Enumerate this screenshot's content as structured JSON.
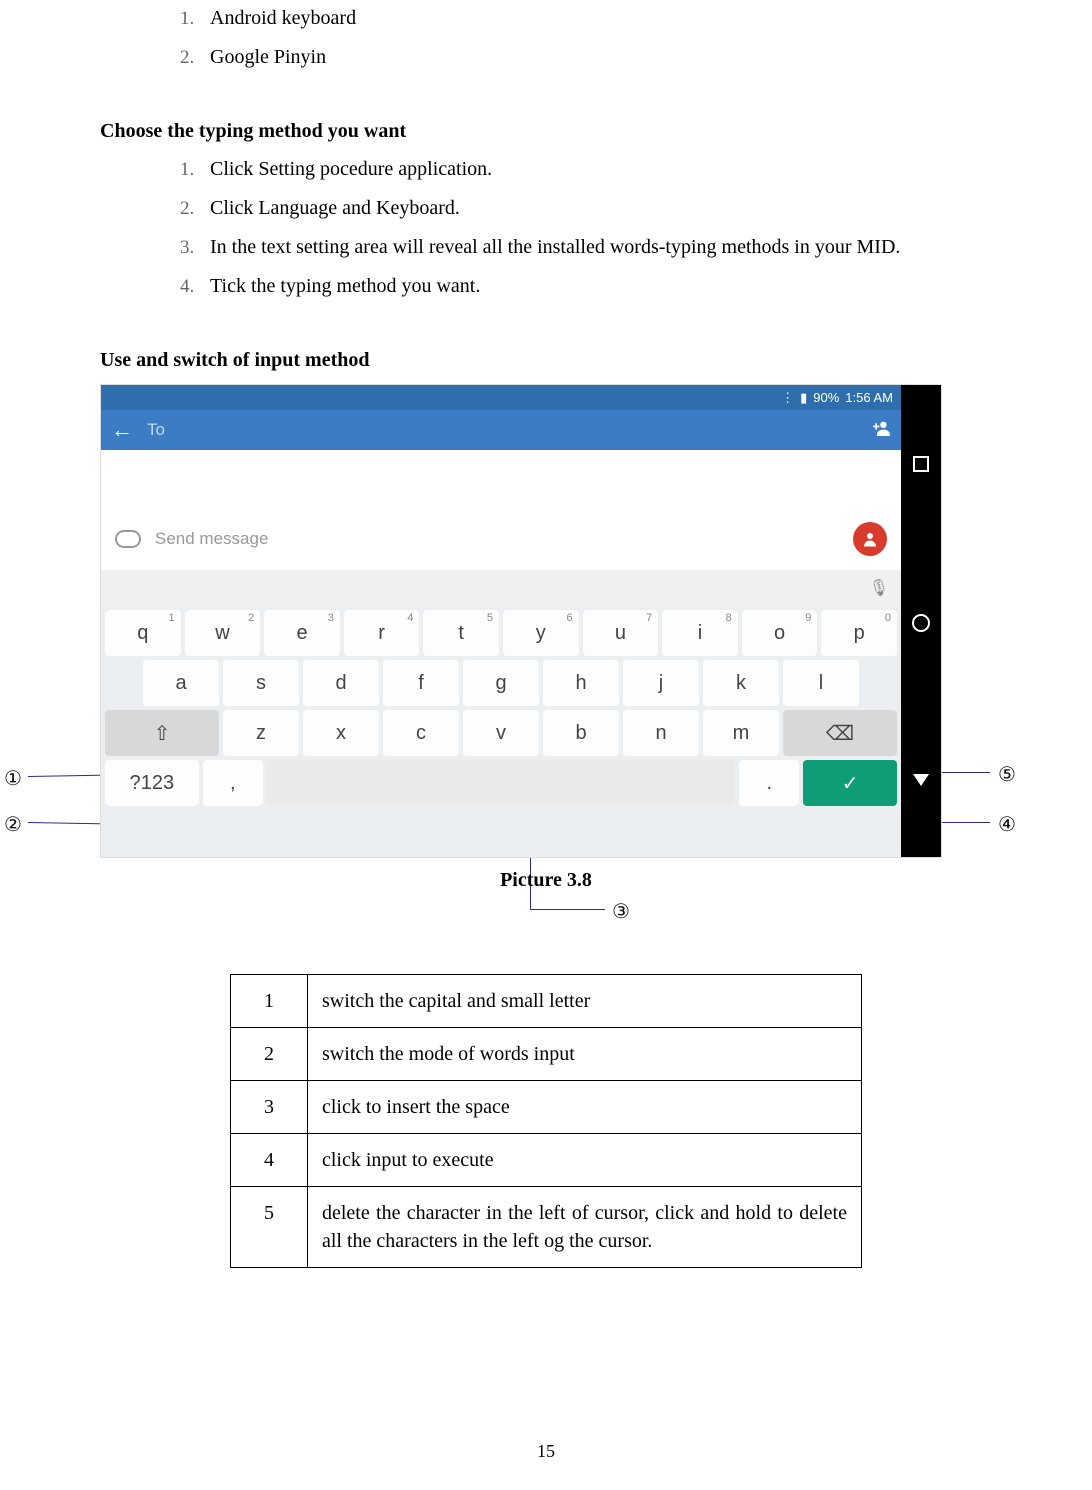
{
  "list_a": {
    "items": [
      {
        "n": "1.",
        "t": "Android keyboard"
      },
      {
        "n": "2.",
        "t": "Google Pinyin"
      }
    ]
  },
  "sect_choose": "Choose the typing method you want",
  "list_b": {
    "items": [
      {
        "n": "1.",
        "t": "Click Setting pocedure application."
      },
      {
        "n": "2.",
        "t": "Click Language and Keyboard."
      },
      {
        "n": "3.",
        "t": "In the text setting area will reveal all the installed words-typing methods in your MID."
      },
      {
        "n": "4.",
        "t": "Tick the typing method you want."
      }
    ]
  },
  "sect_use": "Use and switch of input method",
  "caption": "Picture 3.8",
  "callouts": {
    "c1": "①",
    "c2": "②",
    "c3": "③",
    "c4": "④",
    "c5": "⑤"
  },
  "shot": {
    "status": {
      "battery": "90%",
      "time": "1:56 AM",
      "bt": "▮"
    },
    "topbar": {
      "back": "←",
      "to": "To",
      "add": "+👤"
    },
    "msg": {
      "placeholder": "Send message"
    },
    "mic": "🎙",
    "kbd": {
      "row1": [
        [
          "q",
          "1"
        ],
        [
          "w",
          "2"
        ],
        [
          "e",
          "3"
        ],
        [
          "r",
          "4"
        ],
        [
          "t",
          "5"
        ],
        [
          "y",
          "6"
        ],
        [
          "u",
          "7"
        ],
        [
          "i",
          "8"
        ],
        [
          "o",
          "9"
        ],
        [
          "p",
          "0"
        ]
      ],
      "row2": [
        "a",
        "s",
        "d",
        "f",
        "g",
        "h",
        "j",
        "k",
        "l"
      ],
      "row3": {
        "shift": "⇧",
        "keys": [
          "z",
          "x",
          "c",
          "v",
          "b",
          "n",
          "m"
        ],
        "back": "⌫"
      },
      "row4": {
        "mode": "?123",
        "comma": ",",
        "space": " ",
        "dot": ".",
        "enter": "✓"
      }
    },
    "nav": {
      "sq": "□",
      "ci": "○",
      "tr": "▽"
    }
  },
  "legend": {
    "rows": [
      {
        "n": "1",
        "d": "switch the capital and small letter"
      },
      {
        "n": "2",
        "d": "switch the mode of words input"
      },
      {
        "n": "3",
        "d": "click to insert the space"
      },
      {
        "n": "4",
        "d": "click input to execute"
      },
      {
        "n": "5",
        "d": "delete the character in the left of cursor, click and hold to delete all the characters in the left og the cursor."
      }
    ]
  },
  "page_number": "15"
}
